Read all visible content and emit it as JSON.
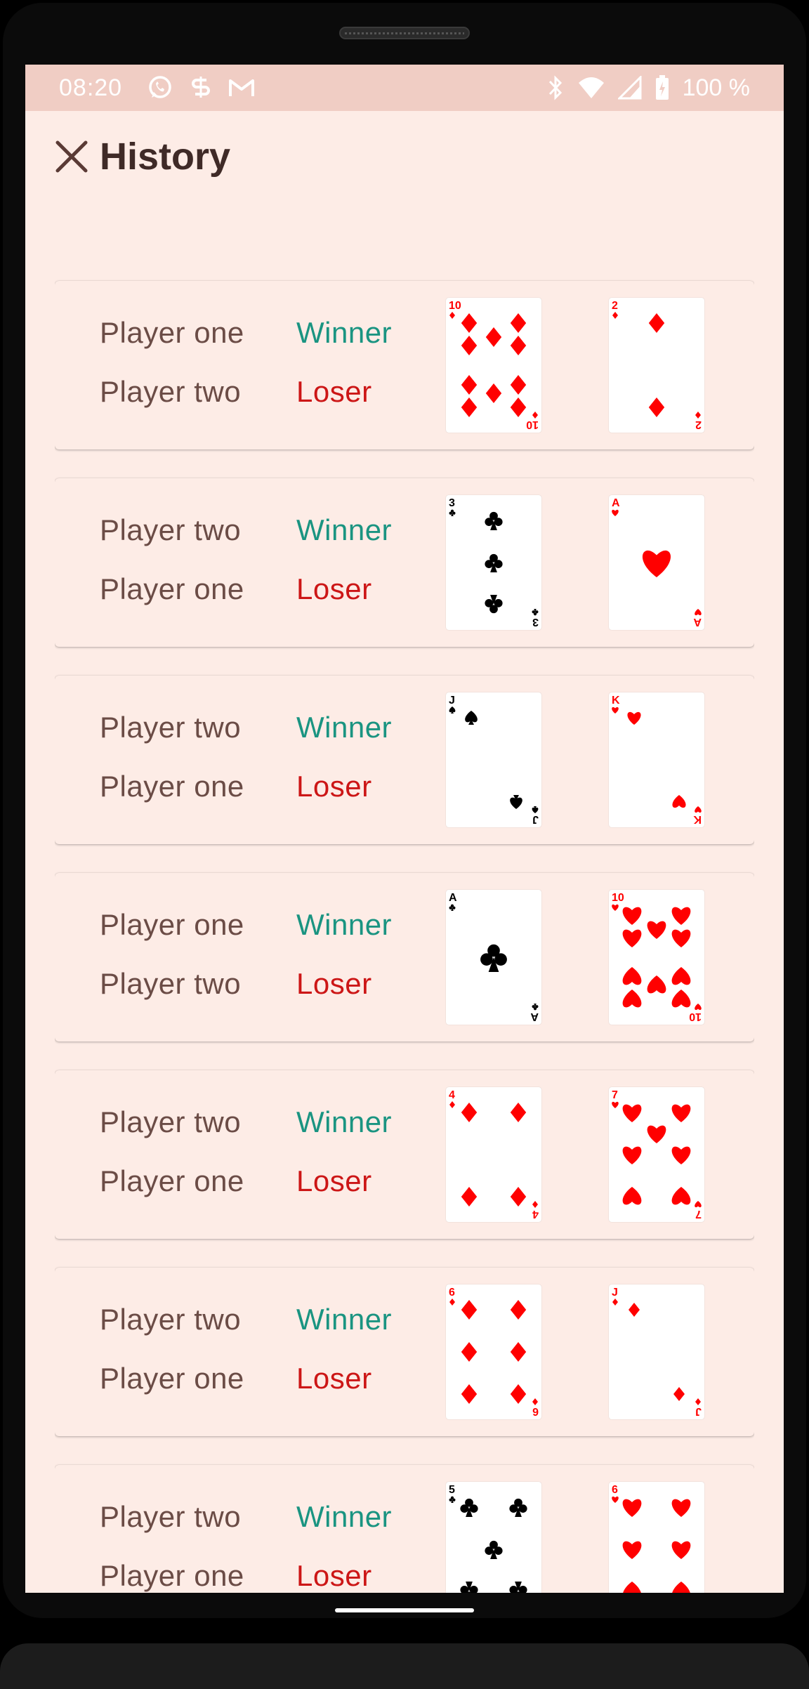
{
  "status_bar": {
    "time": "08:20",
    "battery": "100 %",
    "left_icons": [
      "whatsapp-icon",
      "sync-app-icon",
      "gmail-icon"
    ],
    "right_icons": [
      "bluetooth-icon",
      "wifi-icon",
      "signal-icon",
      "battery-icon"
    ]
  },
  "app_bar": {
    "title": "History",
    "close_icon": "close-icon"
  },
  "colors": {
    "winner": "#1a9481",
    "loser": "#cc1616",
    "red_suit": "#ff0000",
    "black_suit": "#000000",
    "background": "#fdece6"
  },
  "history": [
    {
      "winner_player": "Player one",
      "loser_player": "Player two",
      "winner_label": "Winner",
      "loser_label": "Loser",
      "card1": {
        "rank": "10",
        "suit": "diamonds"
      },
      "card2": {
        "rank": "2",
        "suit": "diamonds"
      }
    },
    {
      "winner_player": "Player two",
      "loser_player": "Player one",
      "winner_label": "Winner",
      "loser_label": "Loser",
      "card1": {
        "rank": "3",
        "suit": "clubs"
      },
      "card2": {
        "rank": "A",
        "suit": "hearts"
      }
    },
    {
      "winner_player": "Player two",
      "loser_player": "Player one",
      "winner_label": "Winner",
      "loser_label": "Loser",
      "card1": {
        "rank": "J",
        "suit": "spades"
      },
      "card2": {
        "rank": "K",
        "suit": "hearts"
      }
    },
    {
      "winner_player": "Player one",
      "loser_player": "Player two",
      "winner_label": "Winner",
      "loser_label": "Loser",
      "card1": {
        "rank": "A",
        "suit": "clubs"
      },
      "card2": {
        "rank": "10",
        "suit": "hearts"
      }
    },
    {
      "winner_player": "Player two",
      "loser_player": "Player one",
      "winner_label": "Winner",
      "loser_label": "Loser",
      "card1": {
        "rank": "4",
        "suit": "diamonds"
      },
      "card2": {
        "rank": "7",
        "suit": "hearts"
      }
    },
    {
      "winner_player": "Player two",
      "loser_player": "Player one",
      "winner_label": "Winner",
      "loser_label": "Loser",
      "card1": {
        "rank": "6",
        "suit": "diamonds"
      },
      "card2": {
        "rank": "J",
        "suit": "diamonds"
      }
    },
    {
      "winner_player": "Player two",
      "loser_player": "Player one",
      "winner_label": "Winner",
      "loser_label": "Loser",
      "card1": {
        "rank": "5",
        "suit": "clubs"
      },
      "card2": {
        "rank": "6",
        "suit": "hearts"
      }
    }
  ]
}
